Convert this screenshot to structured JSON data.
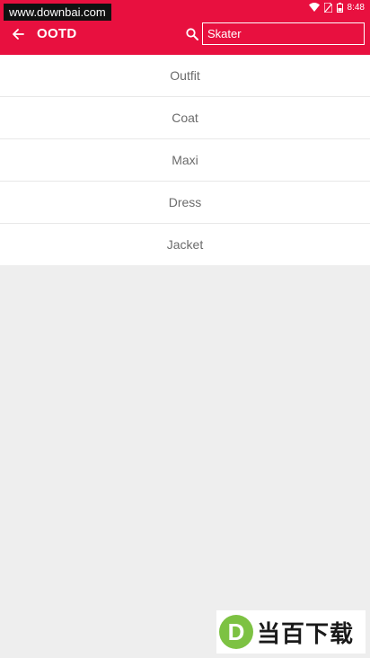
{
  "watermark": {
    "site_text": "www.downbai.com",
    "logo_letter": "D",
    "logo_text": "当百下载"
  },
  "status_bar": {
    "time": "8:48",
    "icons": [
      "wifi-icon",
      "sim-no-signal-icon",
      "battery-icon"
    ]
  },
  "toolbar": {
    "title": "OOTD",
    "back_icon": "back-arrow-icon",
    "search_icon": "search-icon"
  },
  "search": {
    "value": "Skater",
    "placeholder": ""
  },
  "suggestions": [
    {
      "label": "Outfit"
    },
    {
      "label": "Coat"
    },
    {
      "label": "Maxi"
    },
    {
      "label": "Dress"
    },
    {
      "label": "Jacket"
    }
  ],
  "colors": {
    "accent": "#e8103f",
    "background": "#eeeeee",
    "list_background": "#ffffff",
    "list_text": "#6b6b6b",
    "logo_green": "#7dc243"
  }
}
